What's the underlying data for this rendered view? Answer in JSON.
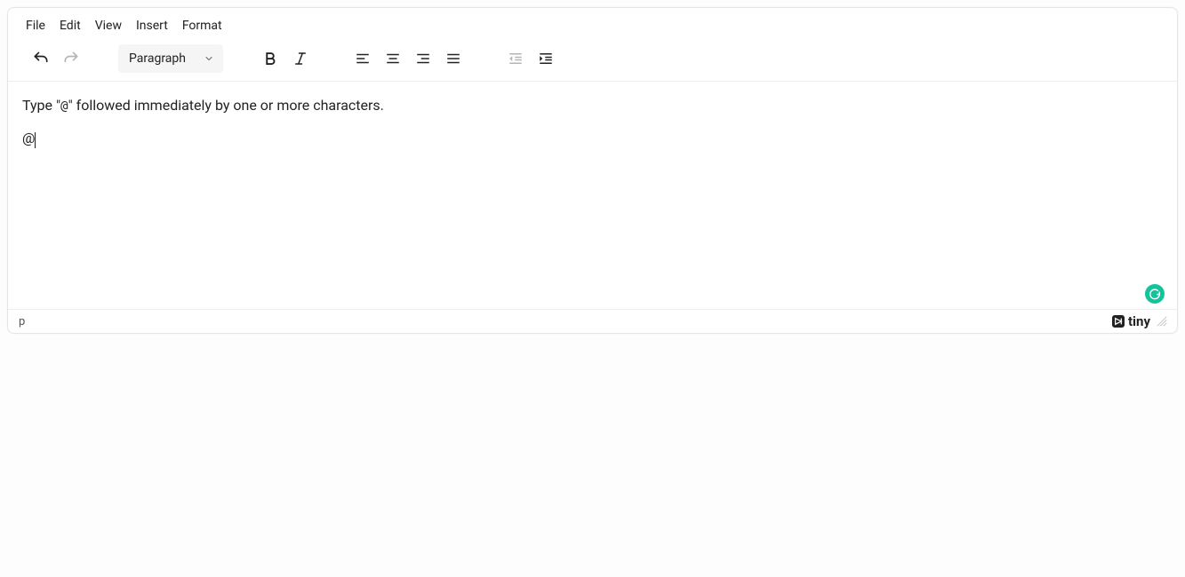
{
  "menubar": {
    "file": "File",
    "edit": "Edit",
    "view": "View",
    "insert": "Insert",
    "format": "Format"
  },
  "toolbar": {
    "block_format": "Paragraph"
  },
  "content": {
    "line1_prefix": "Type \"",
    "line1_code": "@",
    "line1_suffix": "\" followed immediately by one or more characters.",
    "line2": "@"
  },
  "statusbar": {
    "path": "p",
    "brand": "tiny"
  }
}
